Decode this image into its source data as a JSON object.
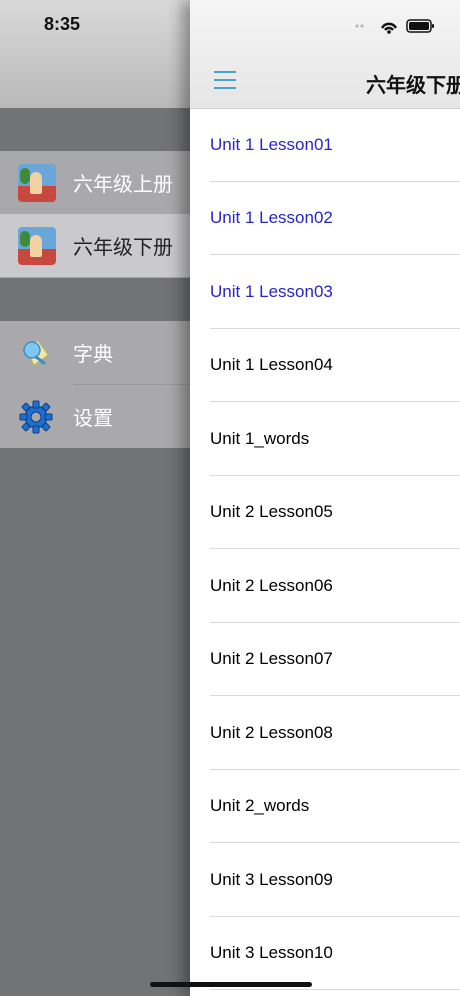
{
  "status_bar": {
    "time": "8:35"
  },
  "side_menu": {
    "group1": [
      {
        "label": "六年级上册",
        "icon": "textbook-cover-thumbnail",
        "selected": false
      },
      {
        "label": "六年级下册",
        "icon": "textbook-cover-thumbnail",
        "selected": true
      }
    ],
    "group2": [
      {
        "label": "字典",
        "icon": "dictionary-icon"
      },
      {
        "label": "设置",
        "icon": "gear-icon"
      }
    ]
  },
  "panel": {
    "nav_title": "六年级下册",
    "menu_icon": "hamburger-menu-icon",
    "accent_color": "#4aa3c9",
    "visited_color": "#2a25c7",
    "lessons": [
      {
        "title": "Unit 1 Lesson01",
        "visited": true
      },
      {
        "title": "Unit 1 Lesson02",
        "visited": true
      },
      {
        "title": "Unit 1 Lesson03",
        "visited": true
      },
      {
        "title": "Unit 1 Lesson04",
        "visited": false
      },
      {
        "title": "Unit 1_words",
        "visited": false
      },
      {
        "title": "Unit 2 Lesson05",
        "visited": false
      },
      {
        "title": "Unit 2 Lesson06",
        "visited": false
      },
      {
        "title": "Unit 2 Lesson07",
        "visited": false
      },
      {
        "title": "Unit 2 Lesson08",
        "visited": false
      },
      {
        "title": "Unit 2_words",
        "visited": false
      },
      {
        "title": "Unit 3 Lesson09",
        "visited": false
      },
      {
        "title": "Unit 3 Lesson10",
        "visited": false
      }
    ]
  }
}
